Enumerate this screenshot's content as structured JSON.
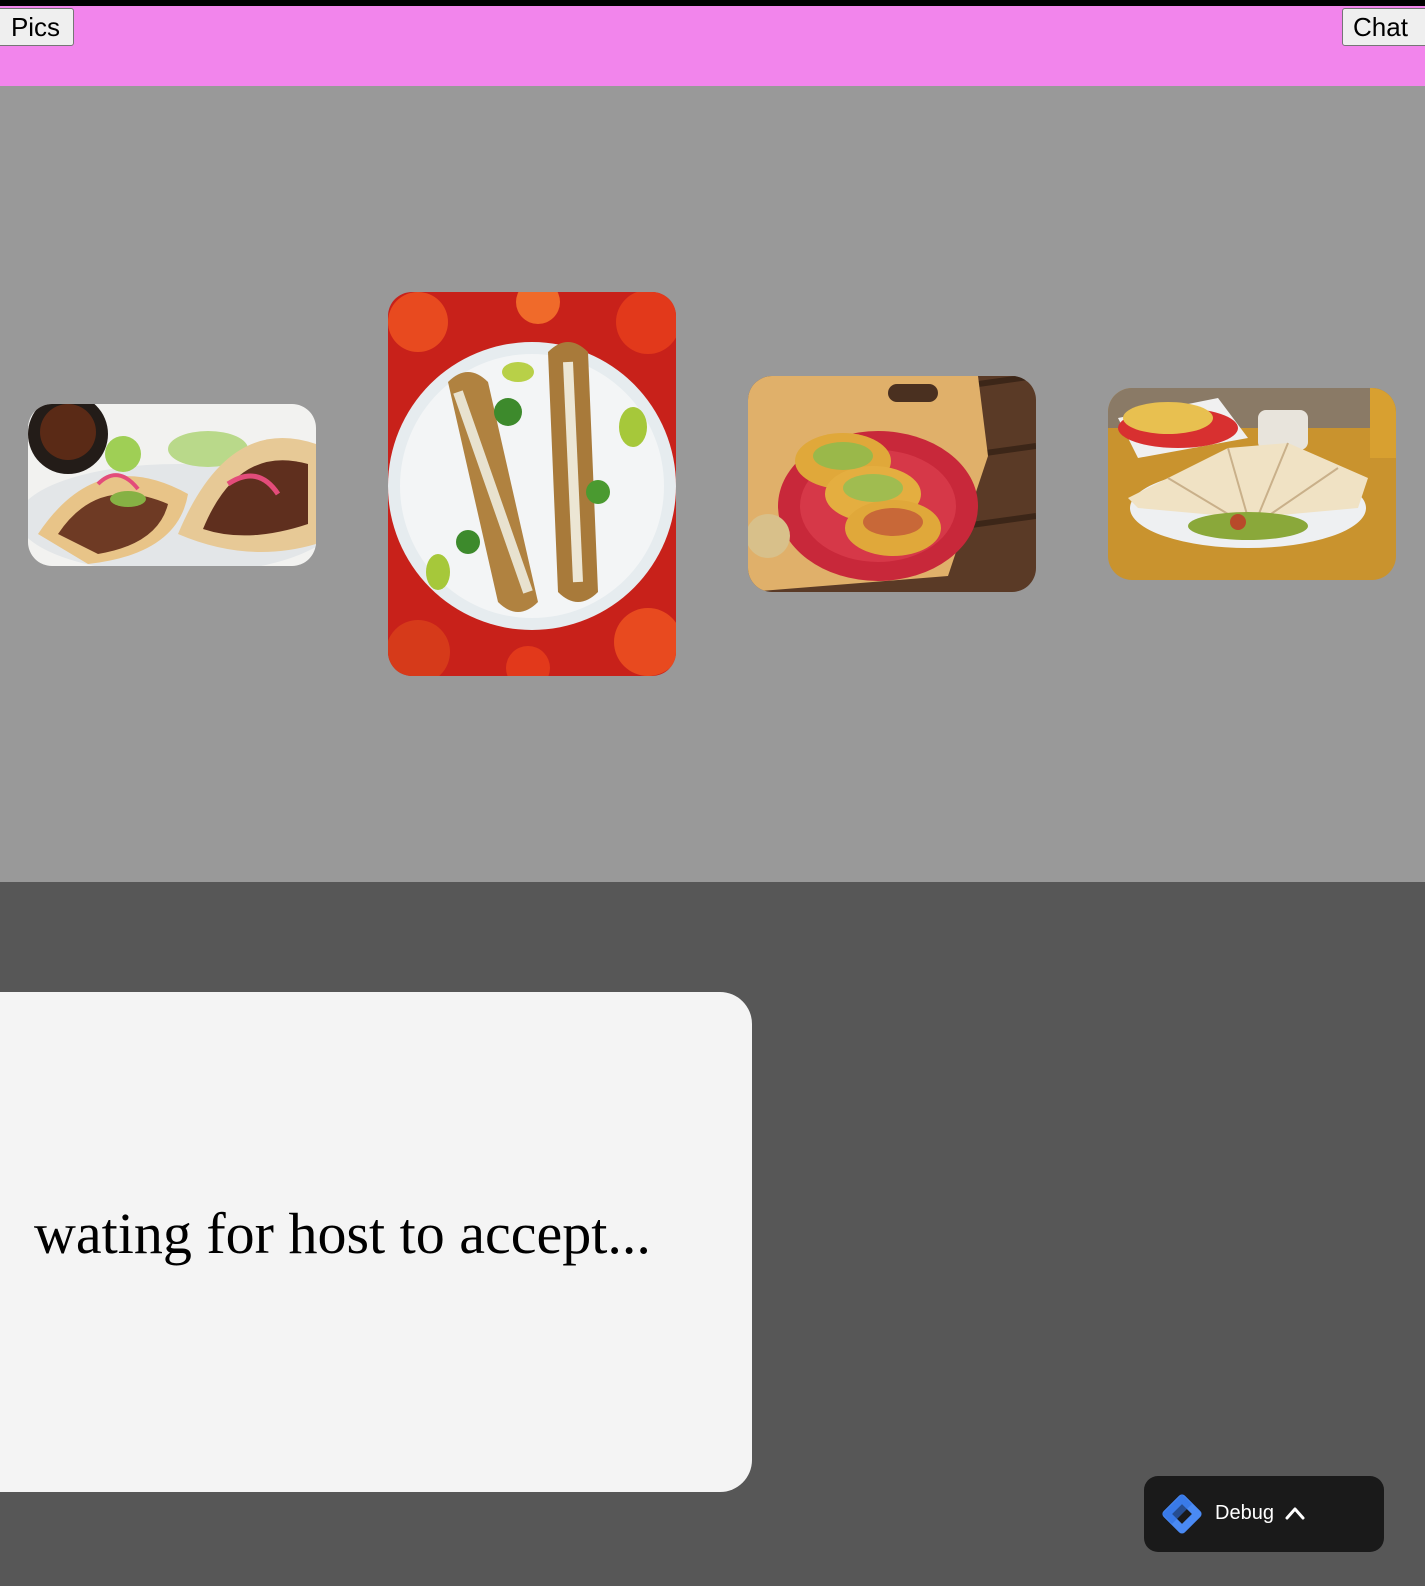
{
  "header": {
    "pics_label": "Pics",
    "chat_label": "Chat",
    "background": "#f285ec"
  },
  "gallery": {
    "background": "#999999",
    "photos": [
      {
        "name": "tacos-photo",
        "subject": "two tacos with avocado and pickled onion"
      },
      {
        "name": "elote-photo",
        "subject": "grilled street corn on a plate"
      },
      {
        "name": "tostadas-photo",
        "subject": "tacos on a red plate"
      },
      {
        "name": "quesadilla-photo",
        "subject": "quesadilla with avocado and chips"
      }
    ]
  },
  "status_card": {
    "message": "wating for host to accept..."
  },
  "debug_widget": {
    "label": "Debug",
    "icon": "tag-manager-diamond-icon",
    "chevron": "chevron-up-icon"
  }
}
